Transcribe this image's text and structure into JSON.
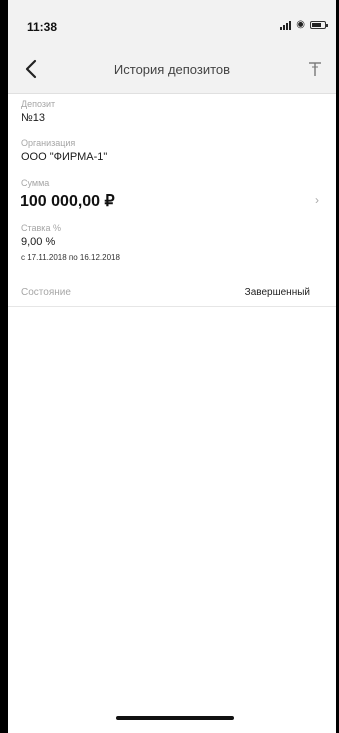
{
  "status_bar": {
    "time": "11:38"
  },
  "header": {
    "title": "История депозитов"
  },
  "deposit": {
    "deposit_label": "Депозит",
    "deposit_value": "№13",
    "org_label": "Организация",
    "org_value": "ООО \"ФИРМА-1\"",
    "amount_label": "Сумма",
    "amount_value": "100 000,00 ₽",
    "rate_label": "Ставка %",
    "rate_value": "9,00 %",
    "period": "с 17.11.2018 по 16.12.2018",
    "state_label": "Состояние",
    "state_value": "Завершенный"
  },
  "icons": {
    "back": "chevron-left-icon",
    "filter": "filter-icon",
    "row_chevron": "chevron-right-icon"
  }
}
